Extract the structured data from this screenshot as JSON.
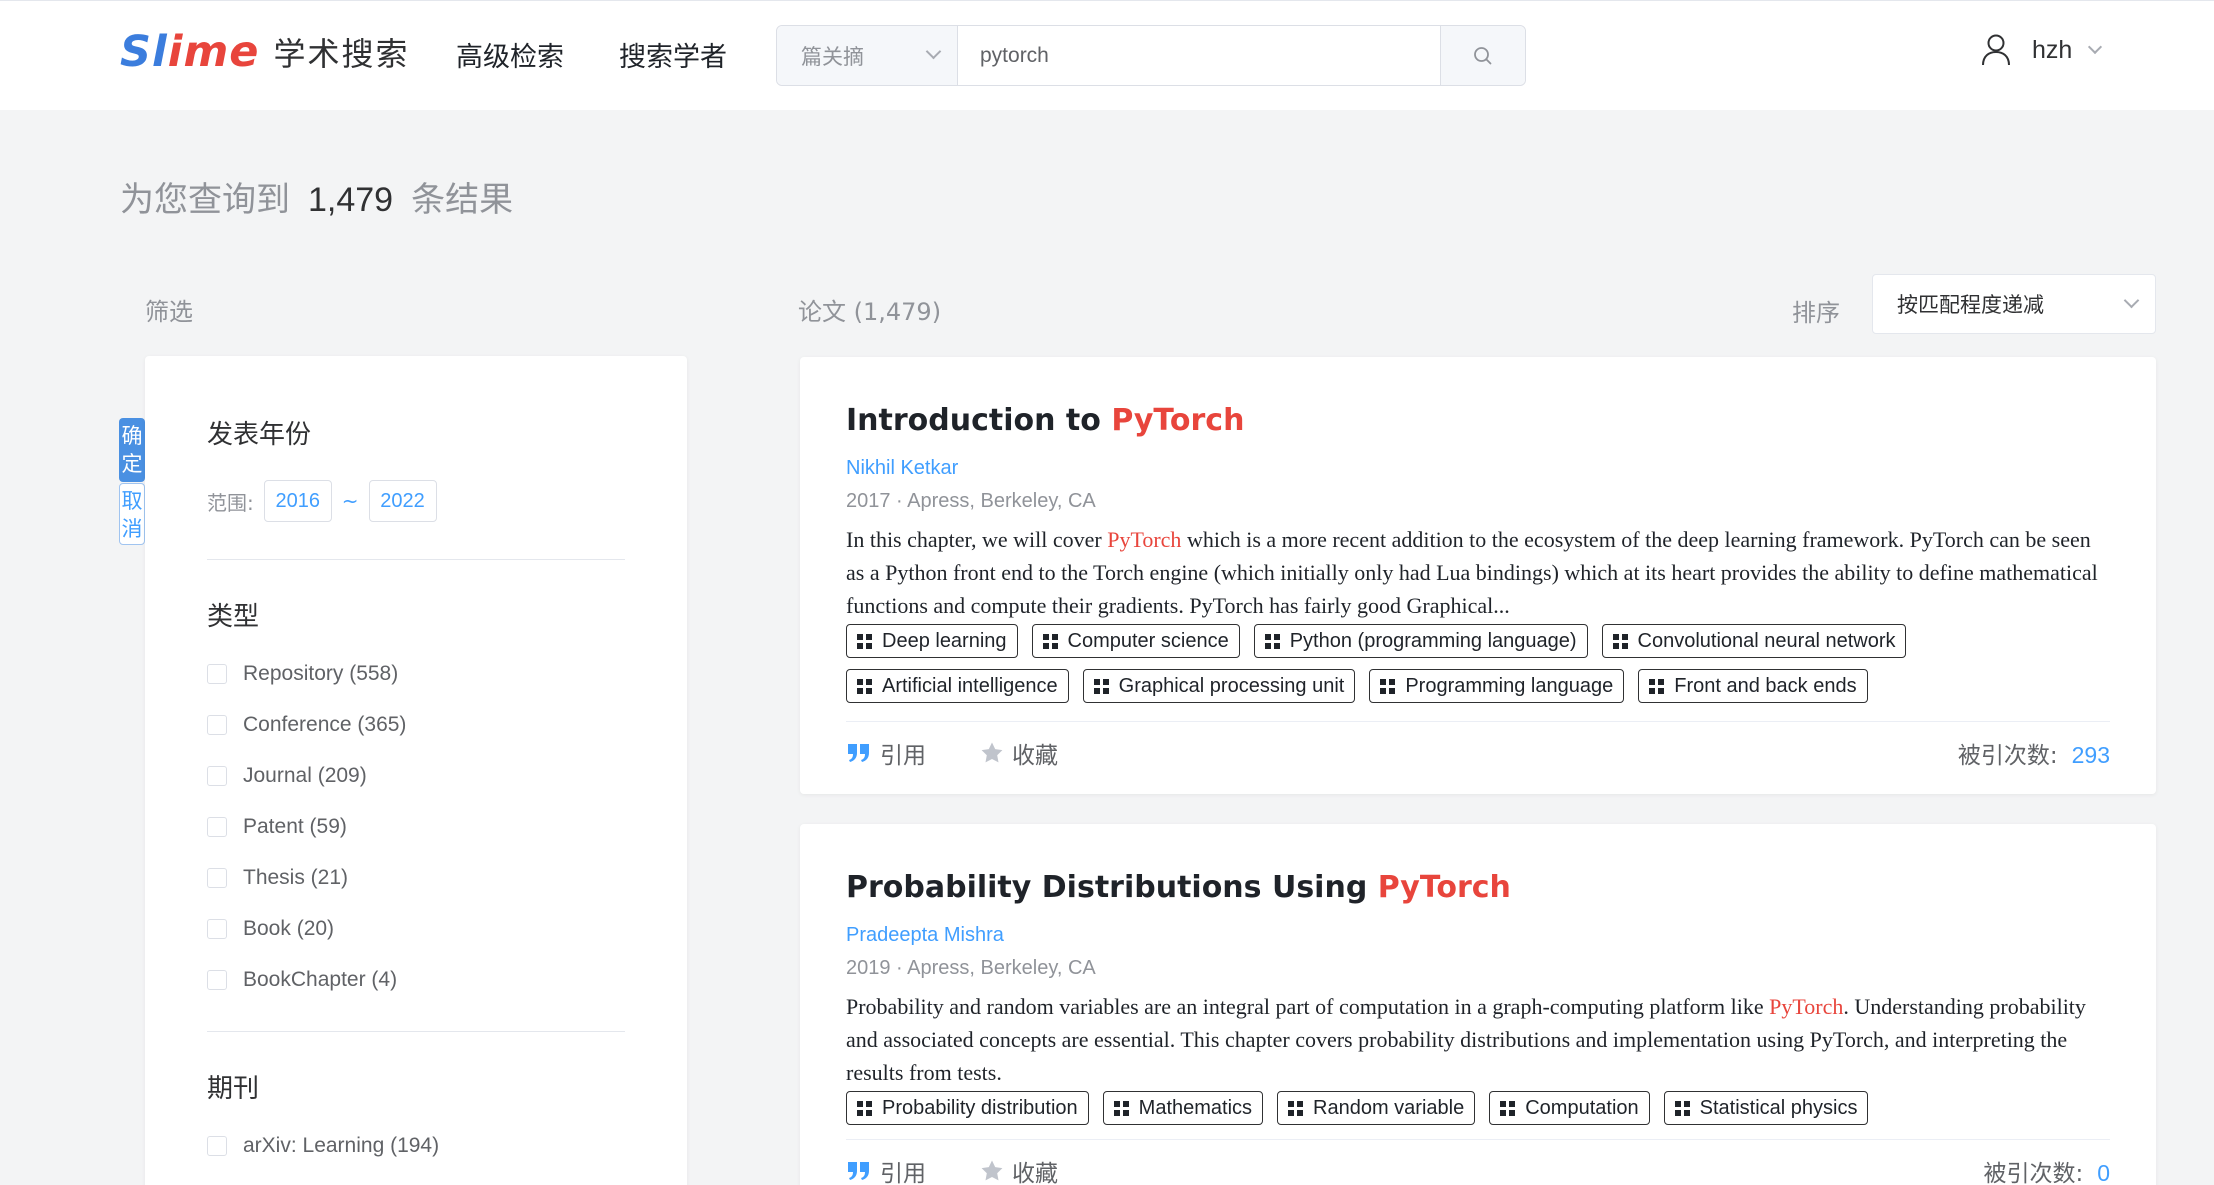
{
  "header": {
    "logo_part1": "Sl",
    "logo_part2": "ime",
    "logo_subtitle": "学术搜索",
    "nav_advanced": "高级检索",
    "nav_scholar": "搜索学者",
    "search_scope": "篇关摘",
    "search_query": "pytorch",
    "user_name": "hzh"
  },
  "summary": {
    "prefix": "为您查询到",
    "count": "1,479",
    "suffix": "条结果"
  },
  "filter": {
    "title": "筛选",
    "confirm_label": [
      "确",
      "定"
    ],
    "cancel_label": [
      "取",
      "消"
    ],
    "year_section": "发表年份",
    "range_label": "范围:",
    "year_from": "2016",
    "year_to": "2022",
    "range_sep": "~",
    "type_section": "类型",
    "types": [
      "Repository (558)",
      "Conference (365)",
      "Journal (209)",
      "Patent (59)",
      "Thesis (21)",
      "Book (20)",
      "BookChapter (4)"
    ],
    "journal_section": "期刊",
    "journals": [
      "arXiv: Learning (194)"
    ]
  },
  "results": {
    "title": "论文 (1,479)",
    "sort_label": "排序",
    "sort_value": "按匹配程度递减",
    "papers": [
      {
        "title_plain": "Introduction to ",
        "title_hl": "PyTorch",
        "title_after": "",
        "authors": "Nikhil Ketkar",
        "venue": "2017 · Apress, Berkeley, CA",
        "abstract_before": "In this chapter, we will cover ",
        "abstract_hl": "PyTorch",
        "abstract_after": " which is a more recent addition to the ecosystem of the deep learning framework. PyTorch can be seen as a Python front end to the Torch engine (which initially only had Lua bindings) which at its heart provides the ability to define mathematical functions and compute their gradients. PyTorch has fairly good Graphical...",
        "tags": [
          "Deep learning",
          "Computer science",
          "Python (programming language)",
          "Convolutional neural network",
          "Artificial intelligence",
          "Graphical processing unit",
          "Programming language",
          "Front and back ends"
        ],
        "cite_action": "引用",
        "fav_action": "收藏",
        "cited_label": "被引次数:",
        "cited_count": "293"
      },
      {
        "title_plain": "Probability Distributions Using ",
        "title_hl": "PyTorch",
        "title_after": "",
        "authors": "Pradeepta Mishra",
        "venue": "2019 · Apress, Berkeley, CA",
        "abstract_before": "Probability and random variables are an integral part of computation in a graph-computing platform like ",
        "abstract_hl": "PyTorch",
        "abstract_after": ". Understanding probability and associated concepts are essential. This chapter covers probability distributions and implementation using PyTorch, and interpreting the results from tests.",
        "tags": [
          "Probability distribution",
          "Mathematics",
          "Random variable",
          "Computation",
          "Statistical physics"
        ],
        "cite_action": "引用",
        "fav_action": "收藏",
        "cited_label": "被引次数:",
        "cited_count": "0"
      }
    ]
  },
  "colors": {
    "accent": "#409eff",
    "highlight": "#e8453c",
    "logo_blue": "#3b7ddd",
    "logo_red": "#e8453c"
  },
  "icons": {
    "search": "search-icon",
    "user": "user-icon",
    "cite": "quote-icon",
    "favorite": "star-icon",
    "tag": "grid-icon"
  }
}
